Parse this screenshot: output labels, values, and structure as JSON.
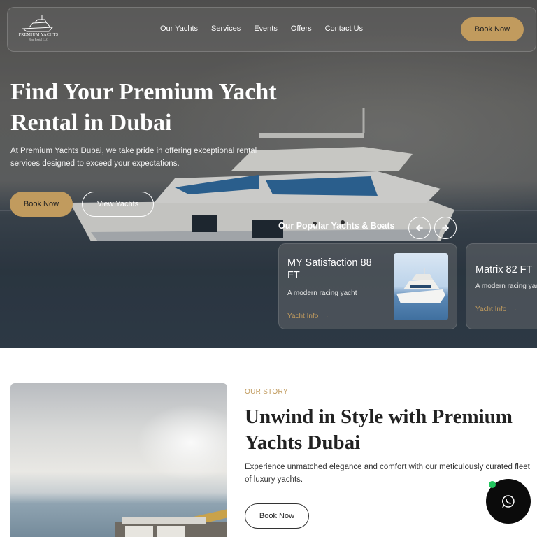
{
  "brand": {
    "logo_text": "PREMIUM YACHTS",
    "logo_sub": "Boat Rental LLC"
  },
  "nav": {
    "items": [
      "Our Yachts",
      "Services",
      "Events",
      "Offers",
      "Contact Us"
    ],
    "book_label": "Book Now"
  },
  "hero": {
    "title": "Find Your Premium Yacht Rental in Dubai",
    "description": "At Premium Yachts Dubai, we take pride in offering exceptional rental services designed to exceed your expectations.",
    "book_label": "Book Now",
    "view_label": "View Yachts"
  },
  "popular": {
    "title": "Our Popular Yachts & Boats",
    "prev_icon": "arrow-left-icon",
    "next_icon": "arrow-right-icon",
    "cards": [
      {
        "name": "MY Satisfaction 88 FT",
        "desc": "A modern racing yacht",
        "link": "Yacht Info"
      },
      {
        "name": "Matrix 82 FT",
        "desc": "A modern racing yacht",
        "link": "Yacht Info"
      }
    ]
  },
  "story": {
    "label": "OUR STORY",
    "title": "Unwind in Style with Premium Yachts Dubai",
    "description": "Experience unmatched elegance and comfort with our meticulously curated fleet of luxury yachts.",
    "book_label": "Book Now"
  },
  "whatsapp": {
    "icon": "whatsapp-icon"
  },
  "colors": {
    "accent": "#c19b5e",
    "dark": "#0b0b0b",
    "online": "#22c55e"
  }
}
